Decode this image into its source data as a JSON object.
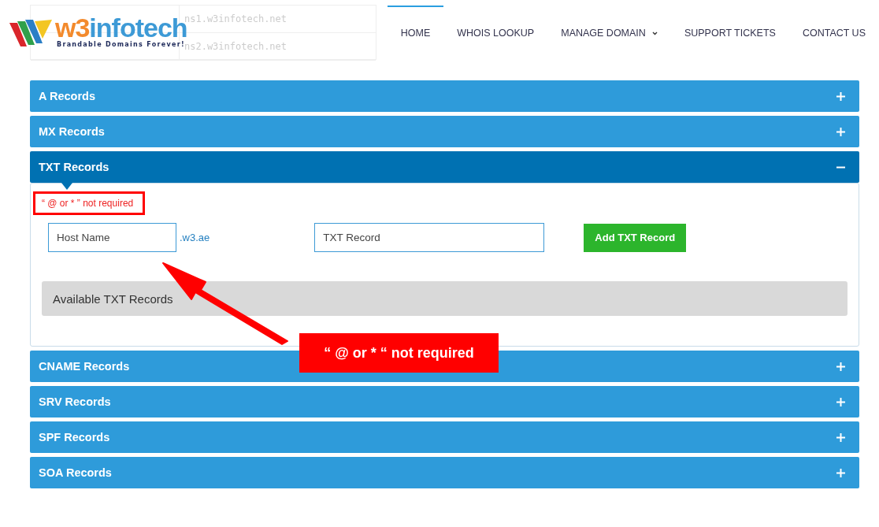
{
  "header": {
    "logo": {
      "brand_first": "w3",
      "brand_rest": "infotech",
      "tagline": "Brandable Domains Forever!"
    },
    "background_table": [
      {
        "column_2": "ns1.w3infotech.net"
      },
      {
        "column_2": "ns2.w3infotech.net"
      }
    ],
    "nav": [
      {
        "label": "HOME",
        "selected": true,
        "dropdown": false
      },
      {
        "label": "WHOIS LOOKUP",
        "selected": false,
        "dropdown": false
      },
      {
        "label": "MANAGE DOMAIN",
        "selected": false,
        "dropdown": true
      },
      {
        "label": "SUPPORT TICKETS",
        "selected": false,
        "dropdown": false
      },
      {
        "label": "CONTACT US",
        "selected": false,
        "dropdown": false
      }
    ]
  },
  "sections": [
    {
      "title": "A Records",
      "expanded": false
    },
    {
      "title": "MX Records",
      "expanded": false
    },
    {
      "title": "TXT Records",
      "expanded": true,
      "body": {
        "note": "“ @ or * ” not required",
        "host_placeholder": "Host Name",
        "domain_suffix": ".w3.ae",
        "record_placeholder": "TXT Record",
        "button": "Add TXT Record",
        "available_title": "Available TXT Records"
      }
    },
    {
      "title": "CNAME Records",
      "expanded": false
    },
    {
      "title": "SRV Records",
      "expanded": false
    },
    {
      "title": "SPF Records",
      "expanded": false
    },
    {
      "title": "SOA Records",
      "expanded": false
    }
  ],
  "callout": {
    "text": "“ @ or * “ not required"
  }
}
